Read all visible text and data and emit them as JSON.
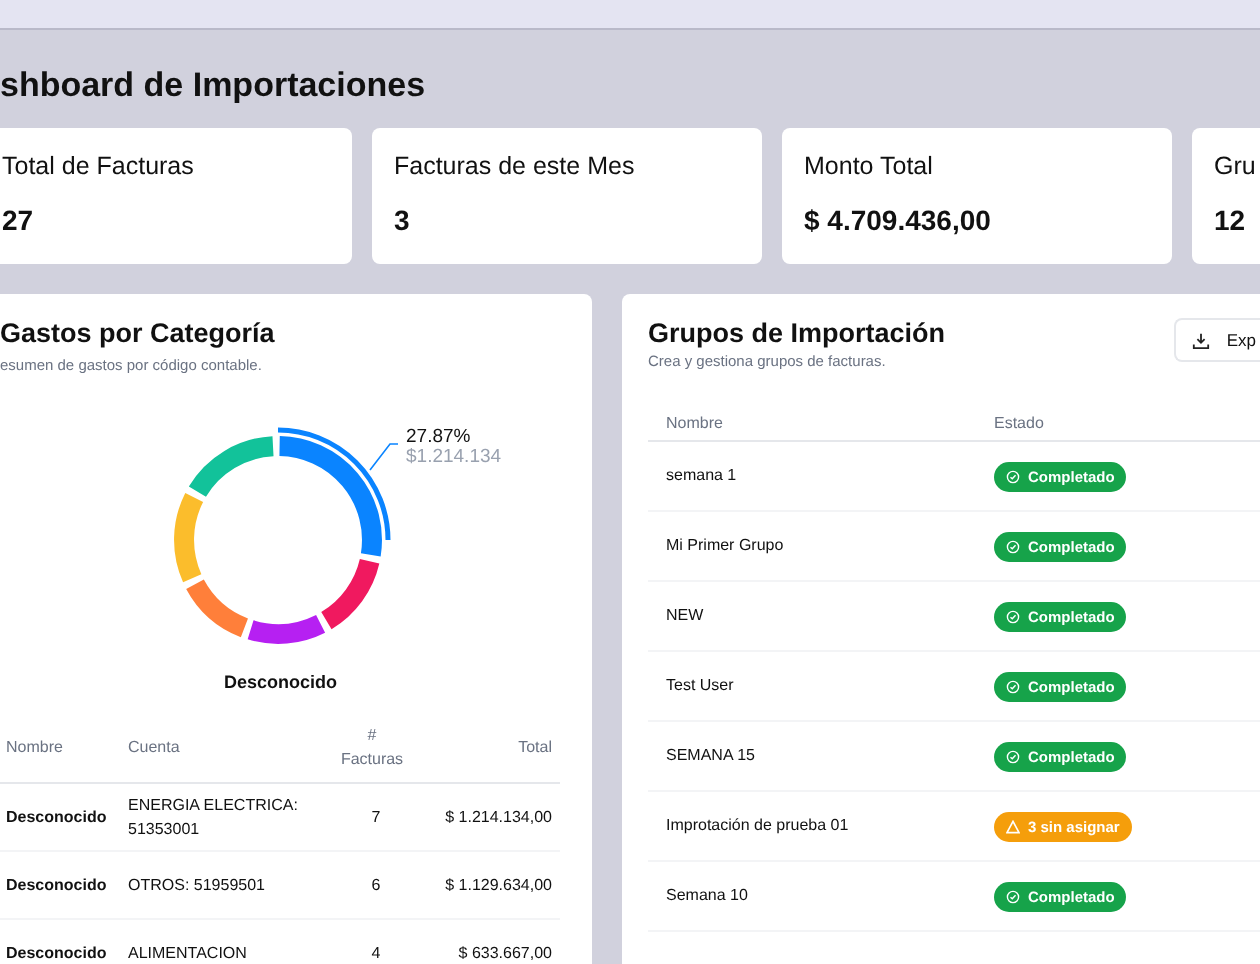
{
  "title": "shboard de Importaciones",
  "stats": [
    {
      "label": "Total de Facturas",
      "value": "27"
    },
    {
      "label": "Facturas de este Mes",
      "value": "3"
    },
    {
      "label": "Monto Total",
      "value": "$ 4.709.436,00"
    },
    {
      "label": "Gru",
      "value": "12"
    }
  ],
  "expenses": {
    "title": "Gastos por Categoría",
    "subtitle": "esumen de gastos por código contable.",
    "highlight_percent": "27.87%",
    "highlight_amount": "$1.214.134",
    "center_label": "Desconocido",
    "columns": [
      "Nombre",
      "Cuenta",
      "# Facturas",
      "Total"
    ],
    "rows": [
      {
        "name": "Desconocido",
        "account": "ENERGIA ELECTRICA: 51353001",
        "count": "7",
        "total": "$ 1.214.134,00"
      },
      {
        "name": "Desconocido",
        "account": "OTROS: 51959501",
        "count": "6",
        "total": "$ 1.129.634,00"
      },
      {
        "name": "Desconocido",
        "account": "ALIMENTACION",
        "count": "4",
        "total": "$ 633.667,00"
      }
    ]
  },
  "groups": {
    "title": "Grupos de Importación",
    "subtitle": "Crea y gestiona grupos de facturas.",
    "export_button": "Exp",
    "columns": [
      "Nombre",
      "Estado"
    ],
    "rows": [
      {
        "name": "semana 1",
        "status": "Completado",
        "kind": "done"
      },
      {
        "name": "Mi Primer Grupo",
        "status": "Completado",
        "kind": "done"
      },
      {
        "name": "NEW",
        "status": "Completado",
        "kind": "done"
      },
      {
        "name": "Test User",
        "status": "Completado",
        "kind": "done"
      },
      {
        "name": "SEMANA 15",
        "status": "Completado",
        "kind": "done"
      },
      {
        "name": "Improtación de prueba 01",
        "status": "3 sin asignar",
        "kind": "warning"
      },
      {
        "name": "Semana 10",
        "status": "Completado",
        "kind": "done"
      }
    ]
  }
}
